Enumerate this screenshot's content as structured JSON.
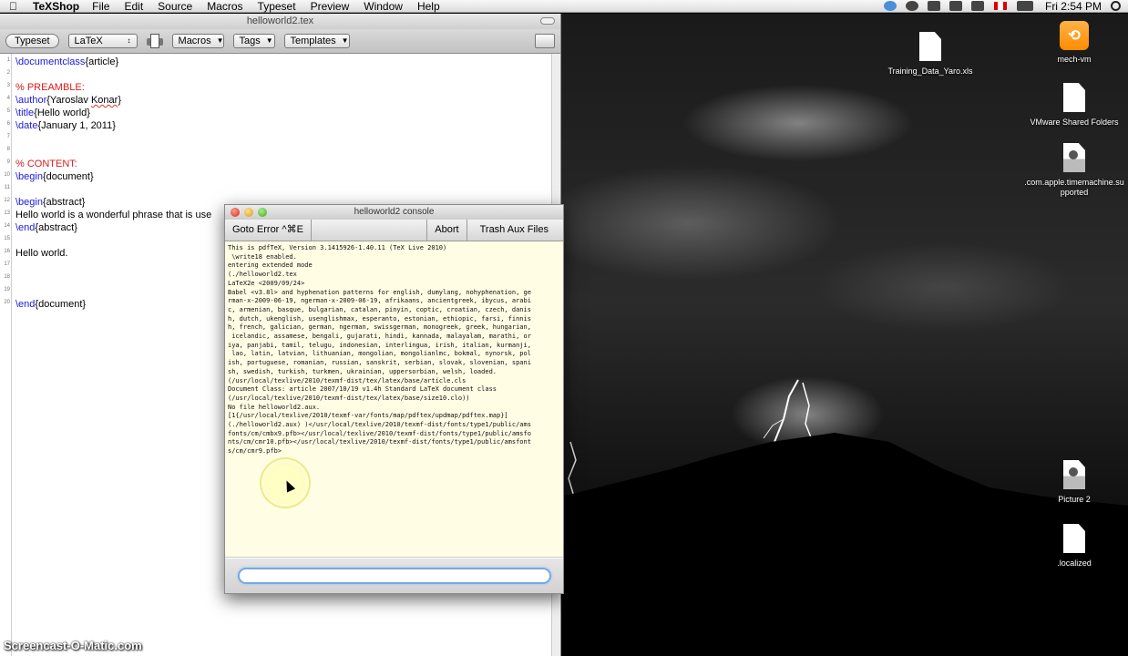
{
  "menubar": {
    "app_name": "TeXShop",
    "menus": [
      "File",
      "Edit",
      "Source",
      "Macros",
      "Typeset",
      "Preview",
      "Window",
      "Help"
    ],
    "clock": "Fri 2:54 PM"
  },
  "editor": {
    "title": "helloworld2.tex",
    "toolbar": {
      "typeset_label": "Typeset",
      "engine_value": "LaTeX",
      "macros_label": "Macros",
      "tags_label": "Tags",
      "templates_label": "Templates"
    },
    "lines": [
      {
        "num": "1",
        "text": ""
      },
      {
        "num": "2",
        "text": ""
      },
      {
        "num": "3",
        "text": ""
      },
      {
        "num": "4",
        "text": ""
      },
      {
        "num": "5",
        "text": ""
      },
      {
        "num": "6",
        "text": ""
      },
      {
        "num": "7",
        "text": ""
      },
      {
        "num": "8",
        "text": ""
      },
      {
        "num": "9",
        "text": ""
      },
      {
        "num": "10",
        "text": ""
      },
      {
        "num": "11",
        "text": ""
      },
      {
        "num": "12",
        "text": ""
      },
      {
        "num": "13",
        "text": ""
      },
      {
        "num": "14",
        "text": ""
      },
      {
        "num": "15",
        "text": ""
      },
      {
        "num": "16",
        "text": ""
      },
      {
        "num": "17",
        "text": ""
      },
      {
        "num": "18",
        "text": ""
      },
      {
        "num": "19",
        "text": ""
      },
      {
        "num": "20",
        "text": ""
      }
    ],
    "code": {
      "l1_cmd": "\\documentclass",
      "l1_arg": "{article}",
      "l3": "% PREAMBLE:",
      "l4_cmd": "\\author",
      "l4_arg_a": "{Yaroslav ",
      "l4_arg_b": "Konar",
      "l4_arg_c": "}",
      "l5_cmd": "\\title",
      "l5_arg": "{Hello world}",
      "l6_cmd": "\\date",
      "l6_arg": "{January 1, 2011}",
      "l9": "% CONTENT:",
      "l10_cmd": "\\begin",
      "l10_arg": "{document}",
      "l12_cmd": "\\begin",
      "l12_arg": "{abstract}",
      "l13": "Hello world is a wonderful phrase that is use",
      "l14_cmd": "\\end",
      "l14_arg": "{abstract}",
      "l16": "Hello world.",
      "l20_cmd": "\\end",
      "l20_arg": "{document}"
    }
  },
  "console": {
    "title": "helloworld2 console",
    "goto_error_label": "Goto Error ^⌘E",
    "abort_label": "Abort",
    "trash_label": "Trash Aux Files",
    "log": "This is pdfTeX, Version 3.1415926-1.40.11 (TeX Live 2010)\n \\write18 enabled.\nentering extended mode\n(./helloworld2.tex\nLaTeX2e <2009/09/24>\nBabel <v3.8l> and hyphenation patterns for english, dumylang, nohyphenation, ge\nrman-x-2009-06-19, ngerman-x-2009-06-19, afrikaans, ancientgreek, ibycus, arabi\nc, armenian, basque, bulgarian, catalan, pinyin, coptic, croatian, czech, danis\nh, dutch, ukenglish, usenglishmax, esperanto, estonian, ethiopic, farsi, finnis\nh, french, galician, german, ngerman, swissgerman, monogreek, greek, hungarian,\n icelandic, assamese, bengali, gujarati, hindi, kannada, malayalam, marathi, or\niya, panjabi, tamil, telugu, indonesian, interlingua, irish, italian, kurmanji,\n lao, latin, latvian, lithuanian, mongolian, mongolianlmc, bokmal, nynorsk, pol\nish, portuguese, romanian, russian, sanskrit, serbian, slovak, slovenian, spani\nsh, swedish, turkish, turkmen, ukrainian, uppersorbian, welsh, loaded.\n(/usr/local/texlive/2010/texmf-dist/tex/latex/base/article.cls\nDocument Class: article 2007/10/19 v1.4h Standard LaTeX document class\n(/usr/local/texlive/2010/texmf-dist/tex/latex/base/size10.clo))\nNo file helloworld2.aux.\n[1{/usr/local/texlive/2010/texmf-var/fonts/map/pdftex/updmap/pdftex.map}]\n(./helloworld2.aux) )</usr/local/texlive/2010/texmf-dist/fonts/type1/public/ams\nfonts/cm/cmbx9.pfb></usr/local/texlive/2010/texmf-dist/fonts/type1/public/amsfo\nnts/cm/cmr10.pfb></usr/local/texlive/2010/texmf-dist/fonts/type1/public/amsfont\ns/cm/cmr9.pfb>",
    "input_value": ""
  },
  "desktop": {
    "icons": [
      {
        "label": "Training_Data_Yaro.xls"
      },
      {
        "label": "mech-vm"
      },
      {
        "label": "VMware Shared Folders"
      },
      {
        "label": ".com.apple.timemachine.supported"
      },
      {
        "label": "Picture 2"
      },
      {
        "label": ".localized"
      }
    ]
  },
  "watermark": "Screencast-O-Matic.com"
}
